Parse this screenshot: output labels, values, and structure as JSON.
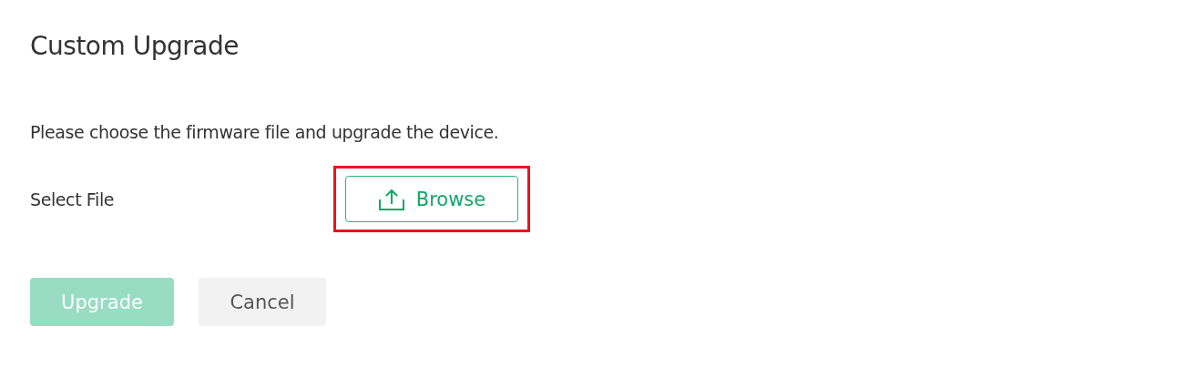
{
  "title": "Custom Upgrade",
  "description": "Please choose the firmware file and upgrade the device.",
  "file_row": {
    "label": "Select File",
    "browse_button": {
      "label": "Browse",
      "highlighted": true
    }
  },
  "buttons": [
    {
      "label": "Upgrade",
      "kind": "primary",
      "disabled": true
    },
    {
      "label": "Cancel",
      "kind": "secondary",
      "disabled": false
    }
  ]
}
